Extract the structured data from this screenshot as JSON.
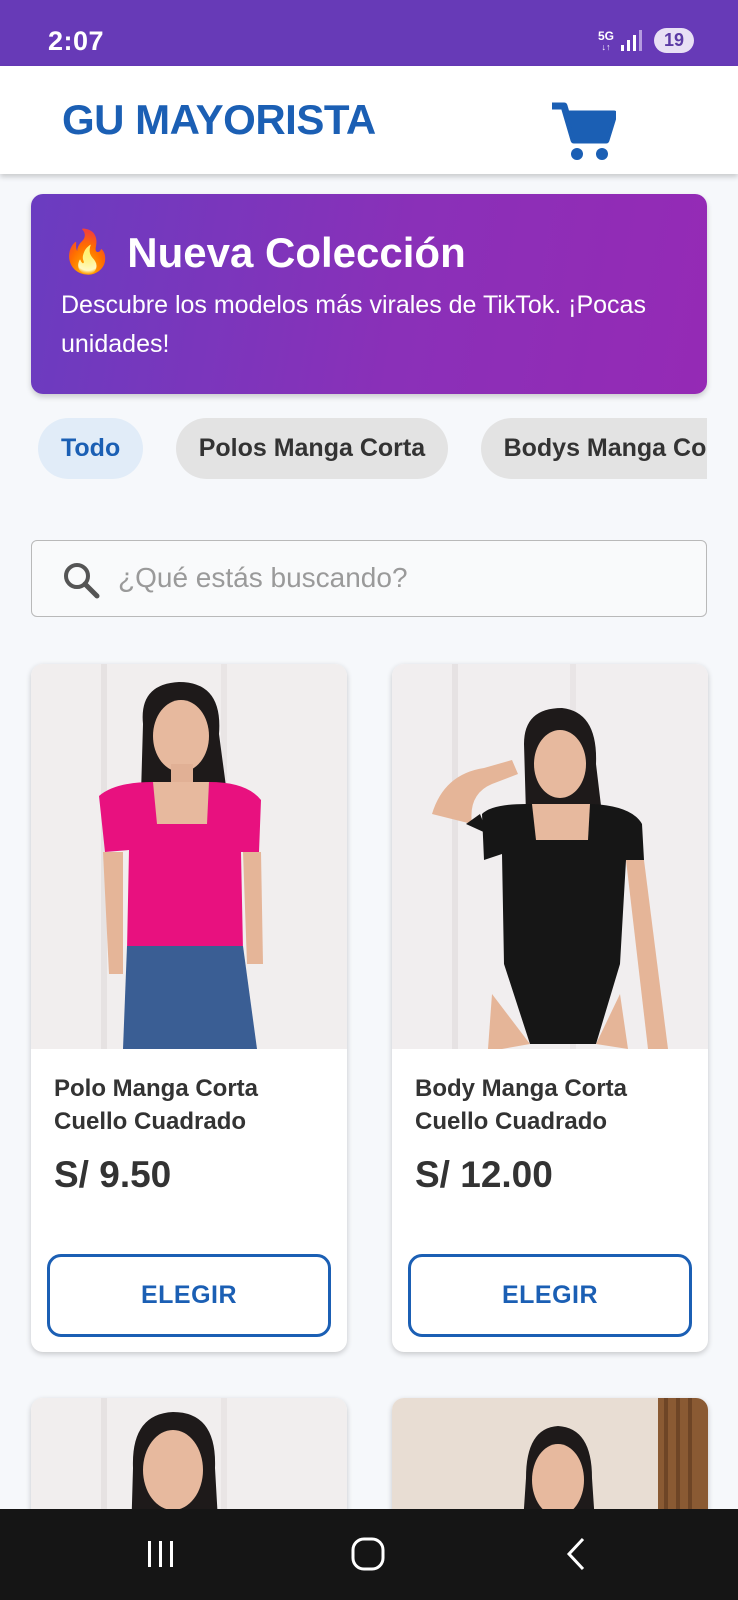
{
  "status_bar": {
    "time": "2:07",
    "network": "5G",
    "battery": "19"
  },
  "header": {
    "brand": "GU MAYORISTA",
    "cart_icon": "cart-icon"
  },
  "promo": {
    "emoji": "🔥",
    "title": "Nueva Colección",
    "text": "Descubre los modelos más virales de TikTok. ¡Pocas unidades!"
  },
  "categories": [
    {
      "label": "Todo",
      "active": true
    },
    {
      "label": "Polos Manga Corta",
      "active": false
    },
    {
      "label": "Bodys Manga Corta",
      "active": false
    }
  ],
  "search": {
    "placeholder": "¿Qué estás buscando?",
    "value": ""
  },
  "products": [
    {
      "name": "Polo Manga Corta Cuello Cuadrado",
      "price": "S/ 9.50",
      "button": "ELEGIR",
      "garment_color": "#e8117f"
    },
    {
      "name": "Body Manga Corta Cuello Cuadrado",
      "price": "S/ 12.00",
      "button": "ELEGIR",
      "garment_color": "#161616"
    }
  ],
  "colors": {
    "status_bar": "#673ab7",
    "brand": "#1b5fb4",
    "promo_start": "#6a3cc0",
    "promo_end": "#952ab5"
  }
}
